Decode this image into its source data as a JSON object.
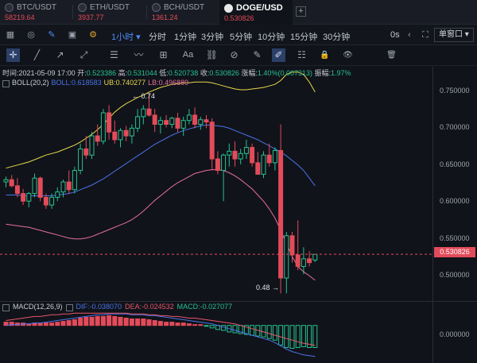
{
  "tabs": [
    {
      "symbol": "BTC/USDT",
      "price": "58219.64",
      "active": false
    },
    {
      "symbol": "ETH/USDT",
      "price": "3937.77",
      "active": false
    },
    {
      "symbol": "BCH/USDT",
      "price": "1361.24",
      "active": false
    },
    {
      "symbol": "DOGE/USD",
      "price": "0.530826",
      "active": true
    }
  ],
  "add_tab_label": "+",
  "toolbar": {
    "interval_selected": "1小时",
    "intervals": [
      "分时",
      "1分钟",
      "3分钟",
      "5分钟",
      "10分钟",
      "15分钟",
      "30分钟"
    ],
    "seconds_label": "0s",
    "window_label": "单窗口"
  },
  "icons": {
    "toolbar": [
      "calendar-icon",
      "target-icon",
      "pencil-icon",
      "save-icon",
      "settings-icon",
      "back-icon",
      "forward-icon",
      "bar-chart-icon",
      "fullscreen-icon"
    ],
    "drawing_tools": [
      "crosshair-icon",
      "line-icon",
      "ray-icon",
      "trend-icon",
      "horizontal-lines-icon",
      "wave-icon",
      "box-icon",
      "text-icon",
      "measure-icon",
      "magnet-icon",
      "ruler-icon",
      "brush-icon",
      "candlestick-icon",
      "lock-icon",
      "eye-icon",
      "trash-icon"
    ],
    "drawing_glyphs": [
      "✛",
      "╱",
      "↗",
      "⤢",
      "☰",
      "〰",
      "⊞",
      "Aa",
      "⛓",
      "⊘",
      "✎",
      "✐",
      "☷",
      "🔒",
      "👁",
      "🗑"
    ]
  },
  "ohlc": {
    "time_label": "时间:",
    "time": "2021-05-09 17:00",
    "open_label": "开:",
    "open": "0.523386",
    "high_label": "高:",
    "high": "0.531044",
    "low_label": "低:",
    "low": "0.520738",
    "close_label": "收:",
    "close": "0.530826",
    "change_label": "涨幅:",
    "change": "1.40%(0.007313)",
    "amplitude_label": "振幅:",
    "amplitude": "1.97%"
  },
  "boll": {
    "name": "BOLL(20,2)",
    "mid": "BOLL:0.618583",
    "ub": "UB:0.740277",
    "lb": "LB:0.496889"
  },
  "macd": {
    "name": "MACD(12,26,9)",
    "dif": "DIF:-0.038070",
    "dea": "DEA:-0.024532",
    "macd": "MACD:-0.027077"
  },
  "annotations": {
    "high": "0.74",
    "low": "0.48"
  },
  "price_axis": [
    "0.750000",
    "0.700000",
    "0.650000",
    "0.600000",
    "0.550000",
    "0.500000"
  ],
  "current_price": "0.530826",
  "macd_axis": [
    "0.000000"
  ],
  "colors": {
    "up": "#26c28e",
    "down": "#e34b5a",
    "boll_mid": "#4a73e8",
    "boll_ub": "#e8d84a",
    "boll_lb": "#e6709a",
    "dif": "#4a73e8",
    "dea": "#e8566a",
    "accent": "#4f8cf7"
  },
  "chart_data": {
    "type": "candlestick",
    "interval": "1小时",
    "ylim": [
      0.47,
      0.775
    ],
    "candles": [
      [
        0.625,
        0.632,
        0.618,
        0.628
      ],
      [
        0.628,
        0.634,
        0.618,
        0.62
      ],
      [
        0.62,
        0.63,
        0.605,
        0.61
      ],
      [
        0.61,
        0.616,
        0.595,
        0.6
      ],
      [
        0.6,
        0.612,
        0.592,
        0.61
      ],
      [
        0.61,
        0.636,
        0.605,
        0.63
      ],
      [
        0.63,
        0.632,
        0.6,
        0.605
      ],
      [
        0.605,
        0.61,
        0.59,
        0.595
      ],
      [
        0.595,
        0.61,
        0.59,
        0.605
      ],
      [
        0.605,
        0.618,
        0.6,
        0.612
      ],
      [
        0.612,
        0.628,
        0.605,
        0.625
      ],
      [
        0.625,
        0.64,
        0.61,
        0.615
      ],
      [
        0.615,
        0.645,
        0.61,
        0.64
      ],
      [
        0.64,
        0.675,
        0.635,
        0.668
      ],
      [
        0.668,
        0.685,
        0.655,
        0.66
      ],
      [
        0.66,
        0.69,
        0.655,
        0.685
      ],
      [
        0.685,
        0.7,
        0.672,
        0.678
      ],
      [
        0.678,
        0.72,
        0.674,
        0.715
      ],
      [
        0.715,
        0.725,
        0.68,
        0.69
      ],
      [
        0.69,
        0.705,
        0.675,
        0.68
      ],
      [
        0.68,
        0.695,
        0.67,
        0.692
      ],
      [
        0.692,
        0.698,
        0.678,
        0.685
      ],
      [
        0.685,
        0.7,
        0.675,
        0.695
      ],
      [
        0.695,
        0.72,
        0.69,
        0.71
      ],
      [
        0.71,
        0.725,
        0.7,
        0.72
      ],
      [
        0.72,
        0.74,
        0.71,
        0.712
      ],
      [
        0.712,
        0.72,
        0.69,
        0.7
      ],
      [
        0.7,
        0.71,
        0.688,
        0.705
      ],
      [
        0.705,
        0.712,
        0.696,
        0.7
      ],
      [
        0.7,
        0.71,
        0.695,
        0.708
      ],
      [
        0.708,
        0.715,
        0.69,
        0.695
      ],
      [
        0.695,
        0.71,
        0.685,
        0.705
      ],
      [
        0.705,
        0.72,
        0.7,
        0.712
      ],
      [
        0.712,
        0.722,
        0.695,
        0.7
      ],
      [
        0.7,
        0.71,
        0.693,
        0.706
      ],
      [
        0.706,
        0.712,
        0.695,
        0.703
      ],
      [
        0.703,
        0.708,
        0.64,
        0.655
      ],
      [
        0.655,
        0.665,
        0.635,
        0.64
      ],
      [
        0.64,
        0.662,
        0.6,
        0.66
      ],
      [
        0.66,
        0.675,
        0.645,
        0.665
      ],
      [
        0.665,
        0.678,
        0.645,
        0.655
      ],
      [
        0.655,
        0.668,
        0.648,
        0.662
      ],
      [
        0.662,
        0.68,
        0.655,
        0.67
      ],
      [
        0.67,
        0.675,
        0.645,
        0.65
      ],
      [
        0.65,
        0.664,
        0.636,
        0.635
      ],
      [
        0.635,
        0.665,
        0.63,
        0.66
      ],
      [
        0.66,
        0.675,
        0.645,
        0.65
      ],
      [
        0.65,
        0.67,
        0.64,
        0.666
      ],
      [
        0.666,
        0.7,
        0.48,
        0.5
      ],
      [
        0.5,
        0.56,
        0.48,
        0.555
      ],
      [
        0.555,
        0.56,
        0.52,
        0.53
      ],
      [
        0.53,
        0.575,
        0.51,
        0.515
      ],
      [
        0.515,
        0.54,
        0.505,
        0.525
      ],
      [
        0.525,
        0.535,
        0.515,
        0.52
      ],
      [
        0.523386,
        0.531044,
        0.520738,
        0.530826
      ]
    ],
    "boll_ub": [
      0.643,
      0.645,
      0.647,
      0.649,
      0.651,
      0.654,
      0.657,
      0.66,
      0.662,
      0.664,
      0.667,
      0.67,
      0.673,
      0.677,
      0.682,
      0.687,
      0.693,
      0.7,
      0.708,
      0.716,
      0.722,
      0.727,
      0.731,
      0.735,
      0.738,
      0.742,
      0.745,
      0.748,
      0.75,
      0.752,
      0.753,
      0.754,
      0.754,
      0.755,
      0.755,
      0.755,
      0.754,
      0.752,
      0.75,
      0.748,
      0.746,
      0.745,
      0.745,
      0.746,
      0.747,
      0.748,
      0.75,
      0.752,
      0.757,
      0.765,
      0.768,
      0.768,
      0.765,
      0.755,
      0.742
    ],
    "boll_mid": [
      0.608,
      0.608,
      0.608,
      0.607,
      0.607,
      0.607,
      0.607,
      0.607,
      0.607,
      0.608,
      0.609,
      0.61,
      0.612,
      0.615,
      0.618,
      0.621,
      0.625,
      0.629,
      0.634,
      0.639,
      0.644,
      0.649,
      0.654,
      0.659,
      0.664,
      0.669,
      0.674,
      0.678,
      0.682,
      0.686,
      0.689,
      0.692,
      0.694,
      0.696,
      0.698,
      0.699,
      0.699,
      0.698,
      0.697,
      0.695,
      0.692,
      0.689,
      0.686,
      0.683,
      0.68,
      0.676,
      0.672,
      0.668,
      0.664,
      0.659,
      0.653,
      0.647,
      0.64,
      0.63,
      0.62
    ],
    "boll_lb": [
      0.57,
      0.569,
      0.568,
      0.567,
      0.566,
      0.564,
      0.562,
      0.56,
      0.558,
      0.556,
      0.554,
      0.552,
      0.551,
      0.551,
      0.552,
      0.554,
      0.557,
      0.56,
      0.563,
      0.566,
      0.569,
      0.572,
      0.576,
      0.581,
      0.587,
      0.594,
      0.601,
      0.607,
      0.613,
      0.619,
      0.624,
      0.628,
      0.632,
      0.636,
      0.638,
      0.64,
      0.641,
      0.641,
      0.64,
      0.637,
      0.633,
      0.628,
      0.622,
      0.616,
      0.608,
      0.6,
      0.59,
      0.578,
      0.562,
      0.545,
      0.528,
      0.515,
      0.508,
      0.503,
      0.497
    ],
    "macd_hist": [
      0.004,
      0.004,
      0.003,
      0.003,
      0.002,
      0.003,
      0.003,
      0.003,
      0.003,
      0.004,
      0.005,
      0.006,
      0.007,
      0.009,
      0.01,
      0.01,
      0.011,
      0.011,
      0.012,
      0.011,
      0.01,
      0.009,
      0.008,
      0.008,
      0.008,
      0.007,
      0.006,
      0.005,
      0.004,
      0.004,
      0.003,
      0.003,
      0.002,
      0.001,
      0.001,
      -0.001,
      -0.003,
      -0.005,
      -0.006,
      -0.008,
      -0.009,
      -0.01,
      -0.011,
      -0.012,
      -0.013,
      -0.014,
      -0.016,
      -0.018,
      -0.024,
      -0.027,
      -0.028,
      -0.027,
      -0.026,
      -0.027,
      -0.027
    ],
    "macd_dif": [
      0.0,
      0.001,
      0.001,
      0.002,
      0.002,
      0.003,
      0.003,
      0.004,
      0.005,
      0.006,
      0.007,
      0.008,
      0.009,
      0.01,
      0.011,
      0.012,
      0.013,
      0.013,
      0.014,
      0.014,
      0.014,
      0.014,
      0.013,
      0.013,
      0.013,
      0.012,
      0.012,
      0.011,
      0.01,
      0.009,
      0.008,
      0.007,
      0.006,
      0.005,
      0.004,
      0.003,
      0.002,
      0.0,
      -0.002,
      -0.004,
      -0.006,
      -0.008,
      -0.01,
      -0.012,
      -0.014,
      -0.016,
      -0.018,
      -0.021,
      -0.025,
      -0.029,
      -0.032,
      -0.034,
      -0.036,
      -0.037,
      -0.038
    ],
    "macd_dea": [
      0.006,
      0.007,
      0.008,
      0.009,
      0.01,
      0.011,
      0.011,
      0.012,
      0.013,
      0.013,
      0.014,
      0.014,
      0.015,
      0.015,
      0.015,
      0.015,
      0.015,
      0.015,
      0.015,
      0.015,
      0.015,
      0.015,
      0.014,
      0.014,
      0.014,
      0.013,
      0.013,
      0.012,
      0.012,
      0.011,
      0.011,
      0.01,
      0.009,
      0.009,
      0.008,
      0.007,
      0.006,
      0.005,
      0.004,
      0.003,
      0.002,
      0.0,
      -0.002,
      -0.004,
      -0.006,
      -0.008,
      -0.01,
      -0.012,
      -0.014,
      -0.016,
      -0.018,
      -0.02,
      -0.022,
      -0.023,
      -0.0245
    ],
    "macd_ylim": [
      -0.045,
      0.025
    ]
  }
}
